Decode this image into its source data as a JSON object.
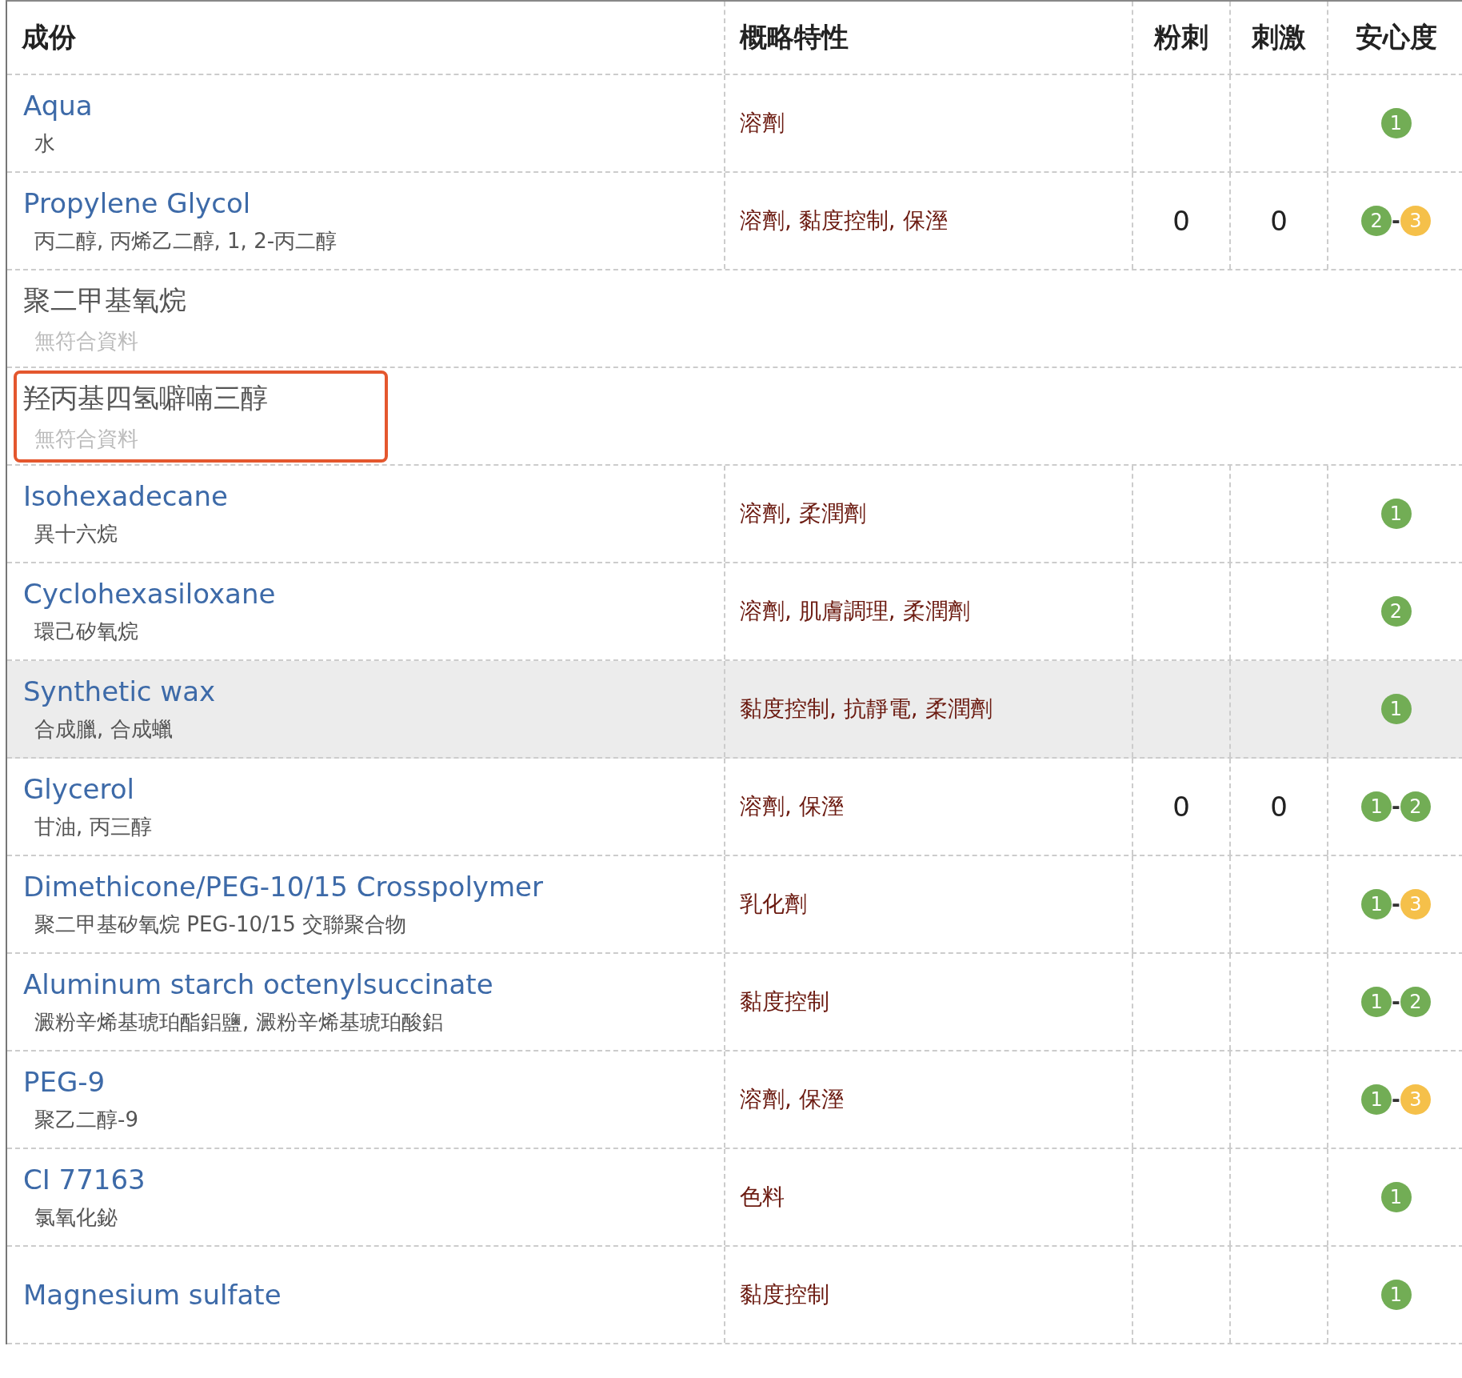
{
  "table": {
    "columns": [
      "成份",
      "概略特性",
      "粉刺",
      "刺激",
      "安心度"
    ],
    "rows": [
      {
        "name": "Aqua",
        "alias": "水",
        "linked": true,
        "properties": "溶劑",
        "safety": [
          {
            "value": "1",
            "color": "#72ad55"
          }
        ],
        "selected": false,
        "outlined": false
      },
      {
        "name": "Propylene Glycol",
        "range_separator": "-",
        "alias": "丙二醇, 丙烯乙二醇, 1, 2-丙二醇",
        "linked": true,
        "properties": "溶劑, 黏度控制, 保溼",
        "acne": "0",
        "irritation": "0",
        "safety": [
          {
            "value": "2",
            "color": "#72ad55"
          },
          {
            "value": "3",
            "color": "#f5c04a"
          }
        ],
        "selected": false,
        "outlined": false
      },
      {
        "name": "聚二甲基氧烷",
        "alias": "無符合資料",
        "linked": false,
        "selected": false,
        "outlined": false
      },
      {
        "name": "羟丙基四氢噼喃三醇",
        "alias": "無符合資料",
        "linked": false,
        "selected": false,
        "outlined": true
      },
      {
        "name": "Isohexadecane",
        "alias": "異十六烷",
        "linked": true,
        "properties": "溶劑, 柔潤劑",
        "safety": [
          {
            "value": "1",
            "color": "#72ad55"
          }
        ],
        "selected": false,
        "outlined": false
      },
      {
        "name": "Cyclohexasiloxane",
        "alias": "環己矽氧烷",
        "linked": true,
        "properties": "溶劑, 肌膚調理, 柔潤劑",
        "safety": [
          {
            "value": "2",
            "color": "#72ad55"
          }
        ],
        "selected": false,
        "outlined": false
      },
      {
        "name": "Synthetic wax",
        "alias": "合成臘, 合成蠟",
        "linked": true,
        "properties": "黏度控制, 抗靜電, 柔潤劑",
        "safety": [
          {
            "value": "1",
            "color": "#72ad55"
          }
        ],
        "selected": true,
        "outlined": false
      },
      {
        "name": "Glycerol",
        "range_separator": "-",
        "alias": "甘油, 丙三醇",
        "linked": true,
        "properties": "溶劑, 保溼",
        "acne": "0",
        "irritation": "0",
        "safety": [
          {
            "value": "1",
            "color": "#72ad55"
          },
          {
            "value": "2",
            "color": "#72ad55"
          }
        ],
        "selected": false,
        "outlined": false
      },
      {
        "name": "Dimethicone/PEG-10/15 Crosspolymer",
        "range_separator": "-",
        "alias": "聚二甲基矽氧烷 PEG-10/15 交聯聚合物",
        "linked": true,
        "properties": "乳化劑",
        "safety": [
          {
            "value": "1",
            "color": "#72ad55"
          },
          {
            "value": "3",
            "color": "#f5c04a"
          }
        ],
        "selected": false,
        "outlined": false
      },
      {
        "name": "Aluminum starch octenylsuccinate",
        "range_separator": "-",
        "alias": "澱粉辛烯基琥珀酯鋁鹽, 澱粉辛烯基琥珀酸鋁",
        "linked": true,
        "properties": "黏度控制",
        "safety": [
          {
            "value": "1",
            "color": "#72ad55"
          },
          {
            "value": "2",
            "color": "#72ad55"
          }
        ],
        "selected": false,
        "outlined": false
      },
      {
        "name": "PEG-9",
        "range_separator": "-",
        "alias": "聚乙二醇-9",
        "linked": true,
        "properties": "溶劑, 保溼",
        "safety": [
          {
            "value": "1",
            "color": "#72ad55"
          },
          {
            "value": "3",
            "color": "#f5c04a"
          }
        ],
        "selected": false,
        "outlined": false
      },
      {
        "name": "CI 77163",
        "alias": "氯氧化鉍",
        "linked": true,
        "properties": "色料",
        "safety": [
          {
            "value": "1",
            "color": "#72ad55"
          }
        ],
        "selected": false,
        "outlined": false
      },
      {
        "name": "Magnesium sulfate",
        "linked": true,
        "properties": "黏度控制",
        "safety": [
          {
            "value": "1",
            "color": "#72ad55"
          }
        ],
        "selected": false,
        "outlined": false
      }
    ]
  }
}
